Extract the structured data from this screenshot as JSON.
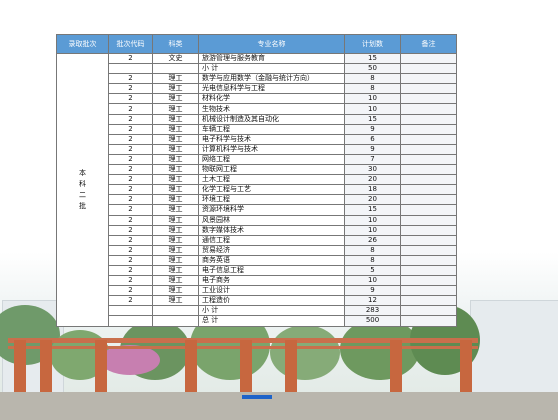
{
  "table": {
    "headers": [
      "录取批次",
      "批次代码",
      "科类",
      "专业名称",
      "计划数",
      "备注"
    ],
    "batch_label": [
      "本",
      "科",
      "二",
      "批"
    ],
    "rows": [
      {
        "code": "2",
        "type": "文史",
        "name": "旅游管理与服务教育",
        "plan": "15"
      },
      {
        "code": "",
        "type": "",
        "name": "小 计",
        "plan": "50"
      },
      {
        "code": "2",
        "type": "理工",
        "name": "数学与应用数学（金融与统计方向）",
        "plan": "8"
      },
      {
        "code": "2",
        "type": "理工",
        "name": "光电信息科学与工程",
        "plan": "8"
      },
      {
        "code": "2",
        "type": "理工",
        "name": "材料化学",
        "plan": "10"
      },
      {
        "code": "2",
        "type": "理工",
        "name": "生物技术",
        "plan": "10"
      },
      {
        "code": "2",
        "type": "理工",
        "name": "机械设计制造及其自动化",
        "plan": "15"
      },
      {
        "code": "2",
        "type": "理工",
        "name": "车辆工程",
        "plan": "9"
      },
      {
        "code": "2",
        "type": "理工",
        "name": "电子科学与技术",
        "plan": "6"
      },
      {
        "code": "2",
        "type": "理工",
        "name": "计算机科学与技术",
        "plan": "9"
      },
      {
        "code": "2",
        "type": "理工",
        "name": "网络工程",
        "plan": "7"
      },
      {
        "code": "2",
        "type": "理工",
        "name": "物联网工程",
        "plan": "30"
      },
      {
        "code": "2",
        "type": "理工",
        "name": "土木工程",
        "plan": "20"
      },
      {
        "code": "2",
        "type": "理工",
        "name": "化学工程与工艺",
        "plan": "18"
      },
      {
        "code": "2",
        "type": "理工",
        "name": "环境工程",
        "plan": "20"
      },
      {
        "code": "2",
        "type": "理工",
        "name": "资源环境科学",
        "plan": "15"
      },
      {
        "code": "2",
        "type": "理工",
        "name": "风景园林",
        "plan": "10"
      },
      {
        "code": "2",
        "type": "理工",
        "name": "数字媒体技术",
        "plan": "10"
      },
      {
        "code": "2",
        "type": "理工",
        "name": "通信工程",
        "plan": "26"
      },
      {
        "code": "2",
        "type": "理工",
        "name": "贸易经济",
        "plan": "8"
      },
      {
        "code": "2",
        "type": "理工",
        "name": "商务英语",
        "plan": "8"
      },
      {
        "code": "2",
        "type": "理工",
        "name": "电子信息工程",
        "plan": "5"
      },
      {
        "code": "2",
        "type": "理工",
        "name": "电子商务",
        "plan": "10"
      },
      {
        "code": "2",
        "type": "理工",
        "name": "工业设计",
        "plan": "9"
      },
      {
        "code": "2",
        "type": "理工",
        "name": "工程造价",
        "plan": "12"
      },
      {
        "code": "",
        "type": "",
        "name": "小 计",
        "plan": "283"
      },
      {
        "code": "",
        "type": "",
        "name": "总 计",
        "plan": "500"
      }
    ]
  },
  "colors": {
    "header_bg": "#5b9bd5",
    "header_text": "#ffffff",
    "pergola": "#c96f4c"
  }
}
